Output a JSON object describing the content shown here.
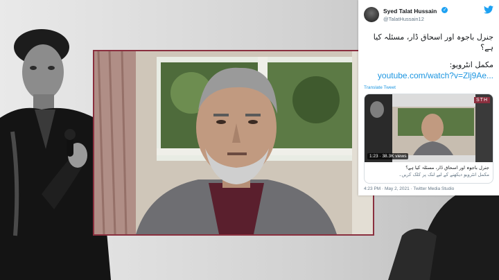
{
  "tweet": {
    "name": "Syed Talat Hussain",
    "handle": "@TalatHussain12",
    "verified_symbol": "✓",
    "twitter_icon": "twitter-bird-icon",
    "text_line1": "جنرل باجوہ اور اسحاق ڈار، مسئلہ کیا ہے؟",
    "text_line2": "مکمل انٹرویو:",
    "link_text": "youtube.com/watch?v=Zlj9Ae...",
    "translate": "Translate Tweet",
    "card": {
      "duration": "1:23",
      "views": "38.3K views",
      "brand": "STH",
      "title": "جنرل باجوہ اور اسحاق ڈار، مسئلہ کیا ہے؟",
      "subtitle": "مکمل انٹرویو دیکھنے کے لیے لنک پر کلک کریں۔"
    },
    "meta": "4:23 PM · May 2, 2021 · Twitter Media Studio"
  },
  "colors": {
    "accent": "#1da1f2",
    "link": "#1b95e0",
    "frame_border": "#8a2f3e"
  }
}
